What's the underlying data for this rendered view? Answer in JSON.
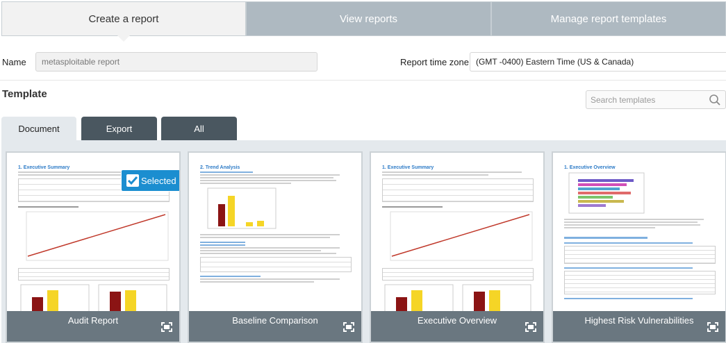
{
  "top_tabs": {
    "create": "Create a report",
    "view": "View reports",
    "manage": "Manage report templates"
  },
  "form": {
    "name_label": "Name",
    "name_value": "metasploitable report",
    "tz_label": "Report time zone",
    "tz_value": "(GMT -0400) Eastern Time (US & Canada)"
  },
  "template": {
    "title": "Template",
    "search_placeholder": "Search templates",
    "tabs": [
      "Document",
      "Export",
      "All"
    ],
    "selected_label": "Selected",
    "cards": [
      {
        "name": "Audit Report",
        "heading": "1. Executive Summary",
        "selected": true
      },
      {
        "name": "Baseline Comparison",
        "heading": "2. Trend Analysis",
        "selected": false
      },
      {
        "name": "Executive Overview",
        "heading": "1. Executive Summary",
        "selected": false
      },
      {
        "name": "Highest Risk Vulnerabilities",
        "heading": "1. Executive Overview",
        "selected": false
      }
    ]
  },
  "colors": {
    "accent": "#1b8ed0",
    "tab_inactive": "#aeb9c1",
    "subtab_dark": "#4a5760",
    "card_bar": "#6a7780"
  }
}
